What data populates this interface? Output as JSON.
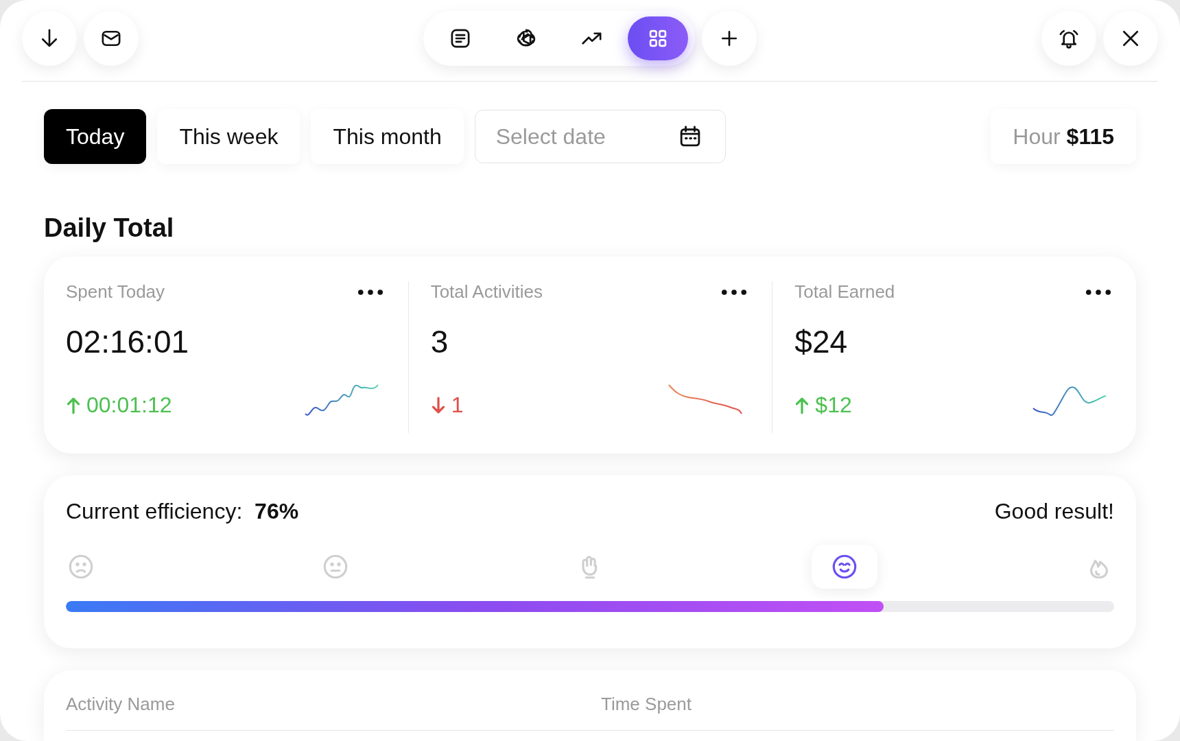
{
  "toolbar": {
    "left": [
      {
        "kind": "download"
      },
      {
        "kind": "mail"
      }
    ],
    "center": [
      {
        "kind": "notes",
        "selected": false
      },
      {
        "kind": "ai",
        "selected": false
      },
      {
        "kind": "trend",
        "selected": false
      },
      {
        "kind": "grid",
        "selected": true
      }
    ],
    "right": [
      {
        "kind": "bell"
      },
      {
        "kind": "close"
      }
    ]
  },
  "filters": [
    {
      "label": "Today",
      "selected": true
    },
    {
      "label": "This week",
      "selected": false
    },
    {
      "label": "This month",
      "selected": false
    }
  ],
  "date_field": {
    "placeholder": "Select date"
  },
  "hour_rate": "Hour **$115**",
  "section_title": "Daily Total",
  "stats": [
    {
      "label": "Spent Today",
      "value": "02:16:01",
      "change": "00:01:12",
      "kind": "up"
    },
    {
      "label": "Total Activities",
      "value": "3",
      "change": "1",
      "kind": "down"
    },
    {
      "label": "Total Earned",
      "value": "$24",
      "change": "$12",
      "kind": "up"
    }
  ],
  "efficiency": {
    "text": "Current efficiency:  **76%**",
    "verdict": "Good result!",
    "level": 0.78,
    "moods": [
      {
        "kind": "sad",
        "selected": false
      },
      {
        "kind": "neutral",
        "selected": false
      },
      {
        "kind": "ok-hand",
        "selected": false
      },
      {
        "kind": "happy",
        "selected": true
      },
      {
        "kind": "fire",
        "selected": false
      }
    ]
  },
  "table": {
    "columns": [
      "Activity Name",
      "Time Spent"
    ]
  }
}
